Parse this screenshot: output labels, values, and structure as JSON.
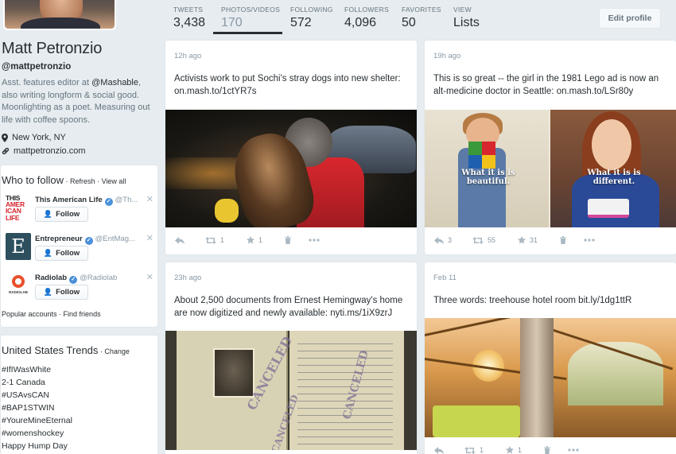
{
  "profile": {
    "name": "Matt Petronzio",
    "handle": "@mattpetronzio",
    "bio_prefix": "Asst. features editor at ",
    "bio_mention": "@Mashable",
    "bio_suffix": ", also writing longform & social good. Moonlighting as a poet. Measuring out life with coffee spoons.",
    "location": "New York, NY",
    "website": "mattpetronzio.com"
  },
  "nav": {
    "stats": [
      {
        "label": "TWEETS",
        "value": "3,438"
      },
      {
        "label": "PHOTOS/VIDEOS",
        "value": "170"
      },
      {
        "label": "FOLLOWING",
        "value": "572"
      },
      {
        "label": "FOLLOWERS",
        "value": "4,096"
      },
      {
        "label": "FAVORITES",
        "value": "50"
      },
      {
        "label": "VIEW",
        "value": "Lists"
      }
    ],
    "edit_profile": "Edit profile"
  },
  "who_to_follow": {
    "title": "Who to follow",
    "refresh": "Refresh",
    "view_all": "View all",
    "dot": " · ",
    "suggestions": [
      {
        "name": "This American Life",
        "handle": "@Th...",
        "button": "Follow"
      },
      {
        "name": "Entrepreneur",
        "handle": "@EntMag...",
        "button": "Follow"
      },
      {
        "name": "Radiolab",
        "handle": "@Radiolab",
        "button": "Follow"
      }
    ],
    "popular_accounts": "Popular accounts",
    "find_friends": "Find friends",
    "logo_text": {
      "tal_1": "THIS",
      "tal_2": "AMER",
      "tal_3": "ICAN",
      "tal_4": "LIFE",
      "ent": "E",
      "radiolab": "RADIOLAB"
    }
  },
  "trends": {
    "title": "United States Trends",
    "change": "Change",
    "items": [
      "#IfIWasWhite",
      "2-1 Canada",
      "#USAvsCAN",
      "#BAP1STWIN",
      "#YoureMineEternal",
      "#womenshockey",
      "Happy Hump Day"
    ]
  },
  "tweets": [
    {
      "time": "12h ago",
      "text": "Activists work to put Sochi's stray dogs into new shelter: on.mash.to/1ctYR7s",
      "retweets": "1",
      "favorites": "1"
    },
    {
      "time": "19h ago",
      "text": "This is so great -- the girl in the 1981 Lego ad is now an alt-medicine doctor in Seattle: on.mash.to/LSr80y",
      "replies": "3",
      "retweets": "55",
      "favorites": "31",
      "media_caption_1": "What it is is beautiful.",
      "media_caption_2": "What it is is different."
    },
    {
      "time": "23h ago",
      "text": "About 2,500 documents from Ernest Hemingway's home are now digitized and newly available: nyti.ms/1iX9zrJ",
      "stamp_1": "CANCELED",
      "stamp_2": "CANCELED",
      "stamp_3": "CANCELED"
    },
    {
      "time": "Feb 11",
      "text": "Three words: treehouse hotel room bit.ly/1dg1ttR",
      "retweets": "1",
      "favorites": "1"
    }
  ],
  "colors": {
    "accent": "#55acee",
    "text": "#292f33",
    "muted": "#8899a6",
    "bg": "#e6ecf0"
  }
}
